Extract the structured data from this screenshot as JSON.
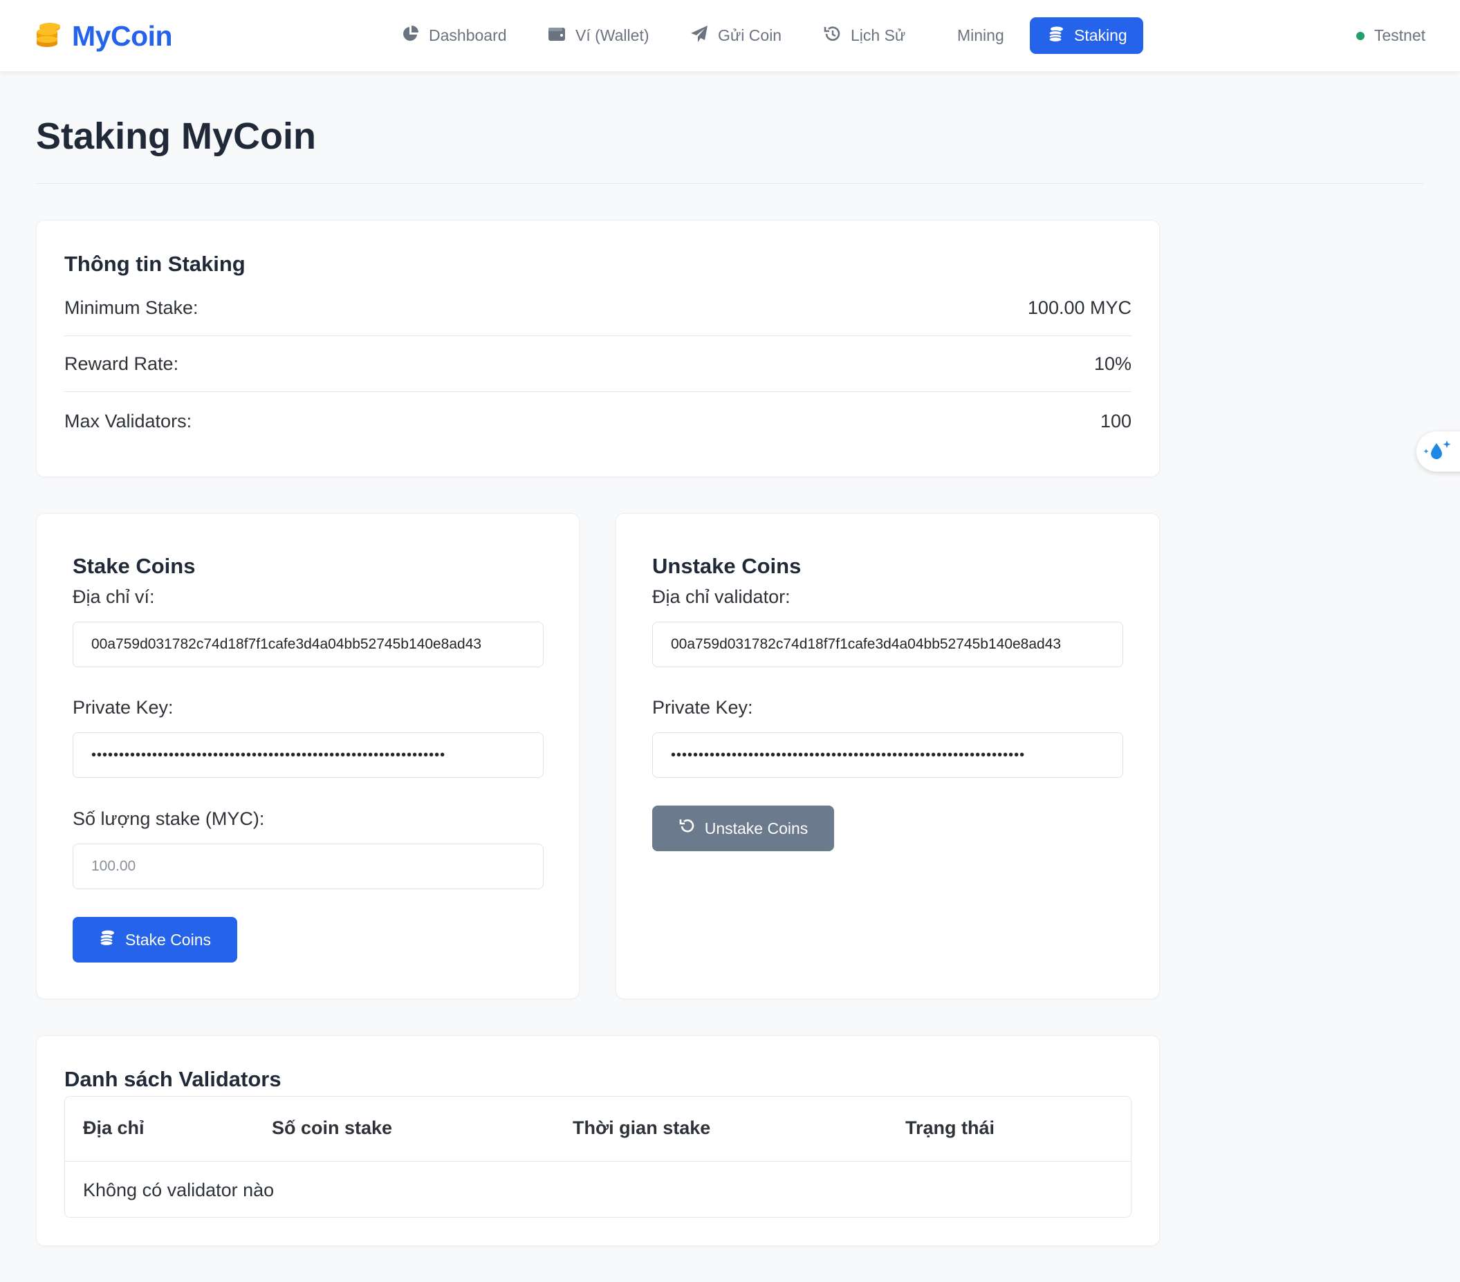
{
  "app": {
    "brand": "MyCoin",
    "network": "Testnet",
    "accent_color": "#2563eb",
    "network_status_color": "#22a06b"
  },
  "nav": {
    "items": [
      {
        "label": "Dashboard",
        "icon": "chart-pie-icon",
        "active": false
      },
      {
        "label": "Ví (Wallet)",
        "icon": "wallet-icon",
        "active": false
      },
      {
        "label": "Gửi Coin",
        "icon": "paper-plane-icon",
        "active": false
      },
      {
        "label": "Lịch Sử",
        "icon": "history-icon",
        "active": false
      },
      {
        "label": "Mining",
        "icon": "",
        "active": false
      },
      {
        "label": "Staking",
        "icon": "coins-icon",
        "active": true
      }
    ]
  },
  "page": {
    "title": "Staking MyCoin"
  },
  "info": {
    "heading": "Thông tin Staking",
    "rows": [
      {
        "label": "Minimum Stake:",
        "value": "100.00 MYC"
      },
      {
        "label": "Reward Rate:",
        "value": "10%"
      },
      {
        "label": "Max Validators:",
        "value": "100"
      }
    ]
  },
  "stake": {
    "heading": "Stake Coins",
    "address_label": "Địa chỉ ví:",
    "address_value": "00a759d031782c74d18f7f1cafe3d4a04bb52745b140e8ad43",
    "key_label": "Private Key:",
    "key_masked": "••••••••••••••••••••••••••••••••••••••••••••••••••••••••••••••••",
    "amount_label": "Số lượng stake (MYC):",
    "amount_placeholder": "100.00",
    "button": "Stake Coins"
  },
  "unstake": {
    "heading": "Unstake Coins",
    "address_label": "Địa chỉ validator:",
    "address_value": "00a759d031782c74d18f7f1cafe3d4a04bb52745b140e8ad43",
    "key_label": "Private Key:",
    "key_masked": "••••••••••••••••••••••••••••••••••••••••••••••••••••••••••••••••",
    "button": "Unstake Coins"
  },
  "validators": {
    "heading": "Danh sách Validators",
    "columns": [
      "Địa chỉ",
      "Số coin stake",
      "Thời gian stake",
      "Trạng thái"
    ],
    "empty_text": "Không có validator nào"
  }
}
